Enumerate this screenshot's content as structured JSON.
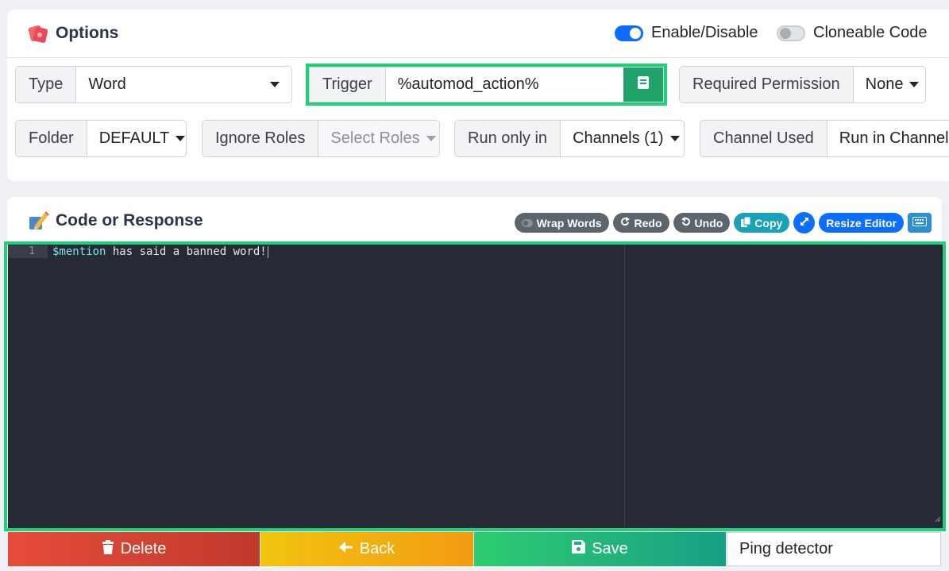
{
  "options": {
    "title": "Options",
    "enable_label": "Enable/Disable",
    "enable_on": true,
    "cloneable_label": "Cloneable Code",
    "cloneable_on": false
  },
  "fields": {
    "type": {
      "label": "Type",
      "value": "Word"
    },
    "trigger": {
      "label": "Trigger",
      "value": "%automod_action%"
    },
    "required_permission": {
      "label": "Required Permission",
      "value": "None"
    },
    "folder": {
      "label": "Folder",
      "value": "DEFAULT"
    },
    "ignore_roles": {
      "label": "Ignore Roles",
      "placeholder": "Select Roles"
    },
    "run_only_in": {
      "label": "Run only in",
      "value": "Channels (1)"
    },
    "channel_used": {
      "label": "Channel Used",
      "value": "Run in Channel"
    }
  },
  "code": {
    "title": "Code or Response",
    "toolbar": {
      "wrap": "Wrap Words",
      "redo": "Redo",
      "undo": "Undo",
      "copy": "Copy",
      "resize": "Resize Editor"
    },
    "line_number": "1",
    "line_var": "$mention",
    "line_rest": " has said a banned word!"
  },
  "actions": {
    "delete": "Delete",
    "back": "Back",
    "save": "Save",
    "name_value": "Ping detector"
  },
  "colors": {
    "highlight": "#1fcf7a",
    "primary": "#0d6efd",
    "editor_bg": "#272935"
  }
}
